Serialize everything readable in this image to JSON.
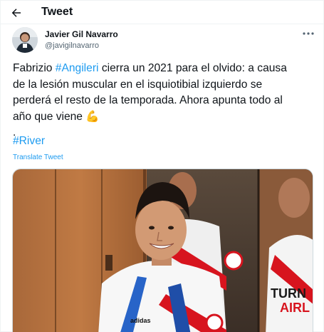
{
  "header": {
    "title": "Tweet",
    "back_icon": "arrow-left-icon"
  },
  "tweet": {
    "author_name": "Javier Gil Navarro",
    "author_handle": "@javigilnavarro",
    "more_icon": "more-horizontal-icon",
    "lines": [
      {
        "pre": "Fabrizio ",
        "hashtag": "#Angileri",
        "post": " cierra un 2021 para el olvido: a causa"
      },
      {
        "pre": "de la lesión muscular en el isquiotibial izquierdo se",
        "hashtag": "",
        "post": ""
      },
      {
        "pre": "perderá el resto de la temporada. Ahora apunta todo al",
        "hashtag": "",
        "post": ""
      },
      {
        "pre": "año que viene 💪",
        "hashtag": "",
        "post": ""
      },
      {
        "pre": ".",
        "hashtag": "",
        "post": ""
      }
    ],
    "hashtag_river": "#River",
    "translate_label": "Translate Tweet",
    "media": {
      "jersey_text": "TURN AIRL",
      "sponsor": "adidas"
    }
  },
  "colors": {
    "link": "#1d9bf0",
    "text": "#0f1419",
    "secondary": "#536471",
    "river_red": "#d7141e"
  }
}
